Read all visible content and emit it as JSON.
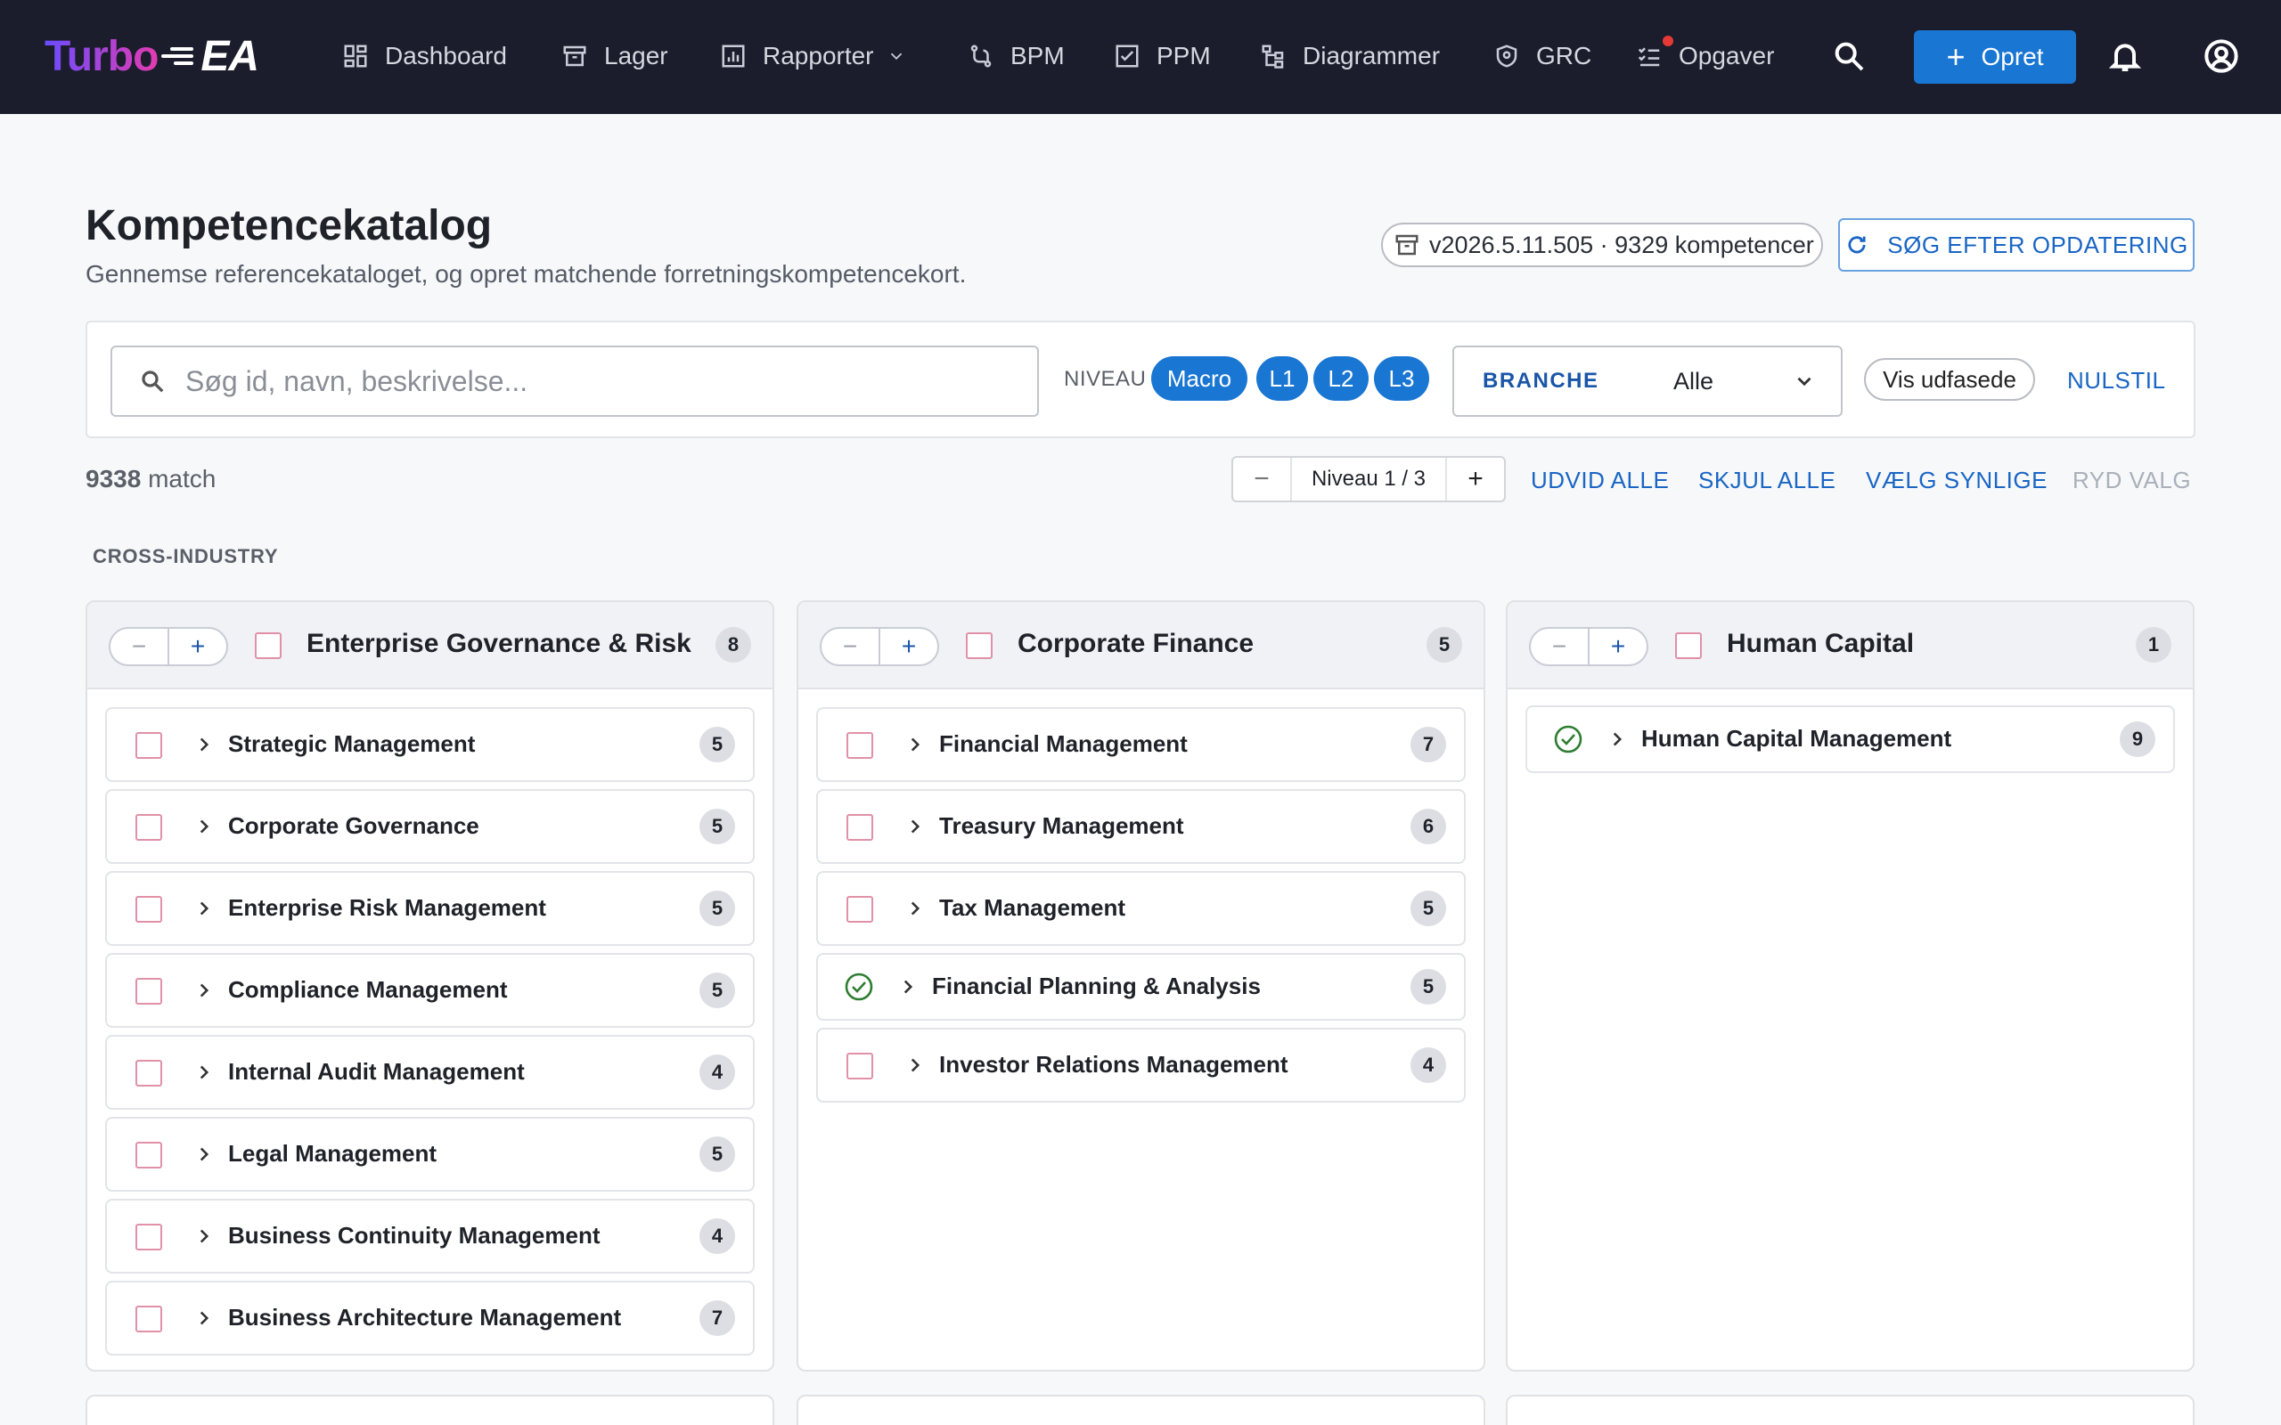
{
  "app": {
    "logo_word": "Turbo",
    "logo_suffix": "EA",
    "nav": [
      {
        "label": "Dashboard"
      },
      {
        "label": "Lager"
      },
      {
        "label": "Rapporter"
      },
      {
        "label": "BPM"
      },
      {
        "label": "PPM"
      },
      {
        "label": "Diagrammer"
      },
      {
        "label": "GRC"
      },
      {
        "label": "Opgaver"
      }
    ],
    "create_label": "Opret"
  },
  "header": {
    "title": "Kompetencekatalog",
    "subtitle": "Gennemse referencekataloget, og opret matchende forretningskompetencekort.",
    "version": "v2026.5.11.505 · 9329 kompetencer",
    "update_label": "SØG EFTER OPDATERING"
  },
  "filters": {
    "search_placeholder": "Søg id, navn, beskrivelse...",
    "level_label": "NIVEAU",
    "levels": [
      "Macro",
      "L1",
      "L2",
      "L3"
    ],
    "branche_label": "BRANCHE",
    "branche_value": "Alle",
    "show_phased": "Vis udfasede",
    "reset": "NULSTIL"
  },
  "results": {
    "count": "9338",
    "count_suffix": "match",
    "level_stepper": "Niveau 1 / 3",
    "expand_all": "UDVID ALLE",
    "collapse_all": "SKJUL ALLE",
    "select_visible": "VÆLG SYNLIGE",
    "clear_selection": "RYD VALG"
  },
  "section": "CROSS-INDUSTRY",
  "columns": [
    {
      "title": "Enterprise Governance & Risk",
      "count": "8",
      "items": [
        {
          "label": "Strategic Management",
          "count": "5",
          "selected": false
        },
        {
          "label": "Corporate Governance",
          "count": "5",
          "selected": false
        },
        {
          "label": "Enterprise Risk Management",
          "count": "5",
          "selected": false
        },
        {
          "label": "Compliance Management",
          "count": "5",
          "selected": false
        },
        {
          "label": "Internal Audit Management",
          "count": "4",
          "selected": false
        },
        {
          "label": "Legal Management",
          "count": "5",
          "selected": false
        },
        {
          "label": "Business Continuity Management",
          "count": "4",
          "selected": false
        },
        {
          "label": "Business Architecture Management",
          "count": "7",
          "selected": false
        }
      ]
    },
    {
      "title": "Corporate Finance",
      "count": "5",
      "items": [
        {
          "label": "Financial Management",
          "count": "7",
          "selected": false
        },
        {
          "label": "Treasury Management",
          "count": "6",
          "selected": false
        },
        {
          "label": "Tax Management",
          "count": "5",
          "selected": false
        },
        {
          "label": "Financial Planning & Analysis",
          "count": "5",
          "selected": true
        },
        {
          "label": "Investor Relations Management",
          "count": "4",
          "selected": false
        }
      ]
    },
    {
      "title": "Human Capital",
      "count": "1",
      "items": [
        {
          "label": "Human Capital Management",
          "count": "9",
          "selected": true
        }
      ]
    }
  ],
  "colors": {
    "nav_bg": "#1b1d2c",
    "accent": "#1976d2",
    "checkbox_border": "#e091a7",
    "success": "#2e7d32"
  }
}
